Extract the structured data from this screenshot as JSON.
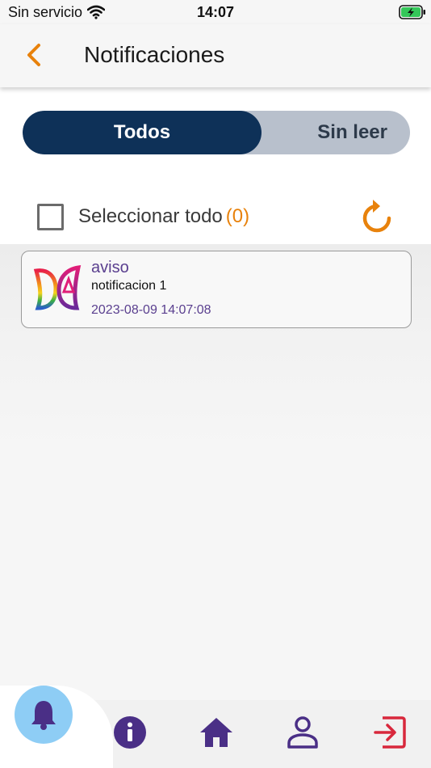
{
  "status_bar": {
    "carrier": "Sin servicio",
    "time": "14:07"
  },
  "header": {
    "title": "Notificaciones"
  },
  "tabs": {
    "all": "Todos",
    "unread": "Sin leer"
  },
  "select_all": {
    "label": "Seleccionar todo",
    "count": "(0)"
  },
  "notifications": [
    {
      "title": "aviso",
      "body": "notificacion 1",
      "date": "2023-08-09 14:07:08"
    }
  ],
  "colors": {
    "accent_orange": "#e8820c",
    "navy": "#0e3158",
    "purple": "#4a2f86",
    "logout_red": "#d8283c",
    "fab_blue": "#8ecdf5"
  },
  "bottom_nav": [
    "bell-icon",
    "info-icon",
    "home-icon",
    "person-icon",
    "logout-icon"
  ]
}
